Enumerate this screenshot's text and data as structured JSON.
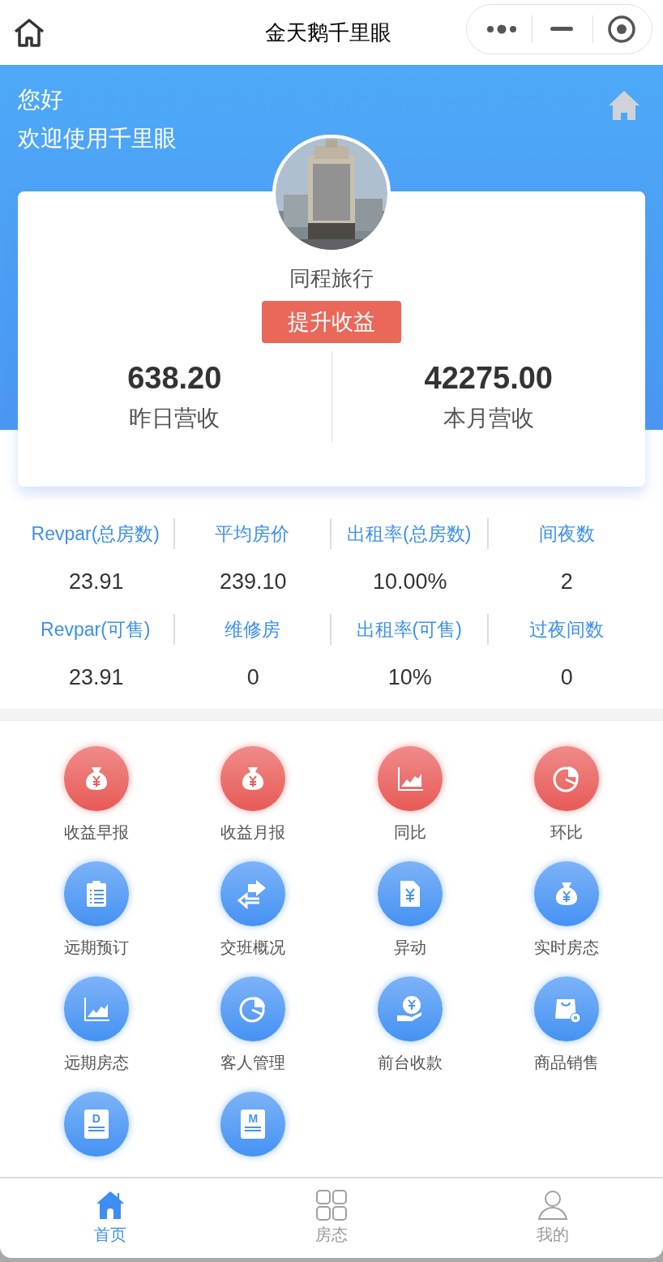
{
  "nav_bar": {
    "title": "金天鹅千里眼"
  },
  "greeting": {
    "line_1": "您好",
    "line_2": "欢迎使用千里眼"
  },
  "hotel_card": {
    "name": "同程旅行",
    "action_button": "提升收益",
    "stats": [
      {
        "value": "638.20",
        "label": "昨日营收"
      },
      {
        "value": "42275.00",
        "label": "本月营收"
      }
    ]
  },
  "metrics": [
    {
      "label": "Revpar(总房数)",
      "value": "23.91"
    },
    {
      "label": "平均房价",
      "value": "239.10"
    },
    {
      "label": "出租率(总房数)",
      "value": "10.00%"
    },
    {
      "label": "间夜数",
      "value": "2"
    },
    {
      "label": "Revpar(可售)",
      "value": "23.91"
    },
    {
      "label": "维修房",
      "value": "0"
    },
    {
      "label": "出租率(可售)",
      "value": "10%"
    },
    {
      "label": "过夜间数",
      "value": "0"
    }
  ],
  "features": [
    {
      "label": "收益早报",
      "kind": "moneybag",
      "color": "#e85a57"
    },
    {
      "label": "收益月报",
      "kind": "moneybag",
      "color": "#e85a57"
    },
    {
      "label": "同比",
      "kind": "chart",
      "color": "#e85a57"
    },
    {
      "label": "环比",
      "kind": "pie",
      "color": "#e85a57"
    },
    {
      "label": "远期预订",
      "kind": "clipboard",
      "color": "#4592f4"
    },
    {
      "label": "交班概况",
      "kind": "swap",
      "color": "#4592f4"
    },
    {
      "label": "异动",
      "kind": "file",
      "color": "#4592f4"
    },
    {
      "label": "实时房态",
      "kind": "moneybag",
      "color": "#4592f4"
    },
    {
      "label": "远期房态",
      "kind": "chart",
      "color": "#4592f4"
    },
    {
      "label": "客人管理",
      "kind": "pie",
      "color": "#4592f4"
    },
    {
      "label": "前台收款",
      "kind": "hand",
      "color": "#4592f4"
    },
    {
      "label": "商品销售",
      "kind": "bag",
      "color": "#4592f4"
    },
    {
      "kind": "letter",
      "letter": "D",
      "color": "#4592f4"
    },
    {
      "kind": "letter",
      "letter": "M",
      "color": "#4592f4"
    }
  ],
  "tab_bar": [
    {
      "label": "首页",
      "kind": "home",
      "selected": true
    },
    {
      "label": "房态",
      "kind": "grid",
      "selected": false
    },
    {
      "label": "我的",
      "kind": "user",
      "selected": false
    }
  ]
}
